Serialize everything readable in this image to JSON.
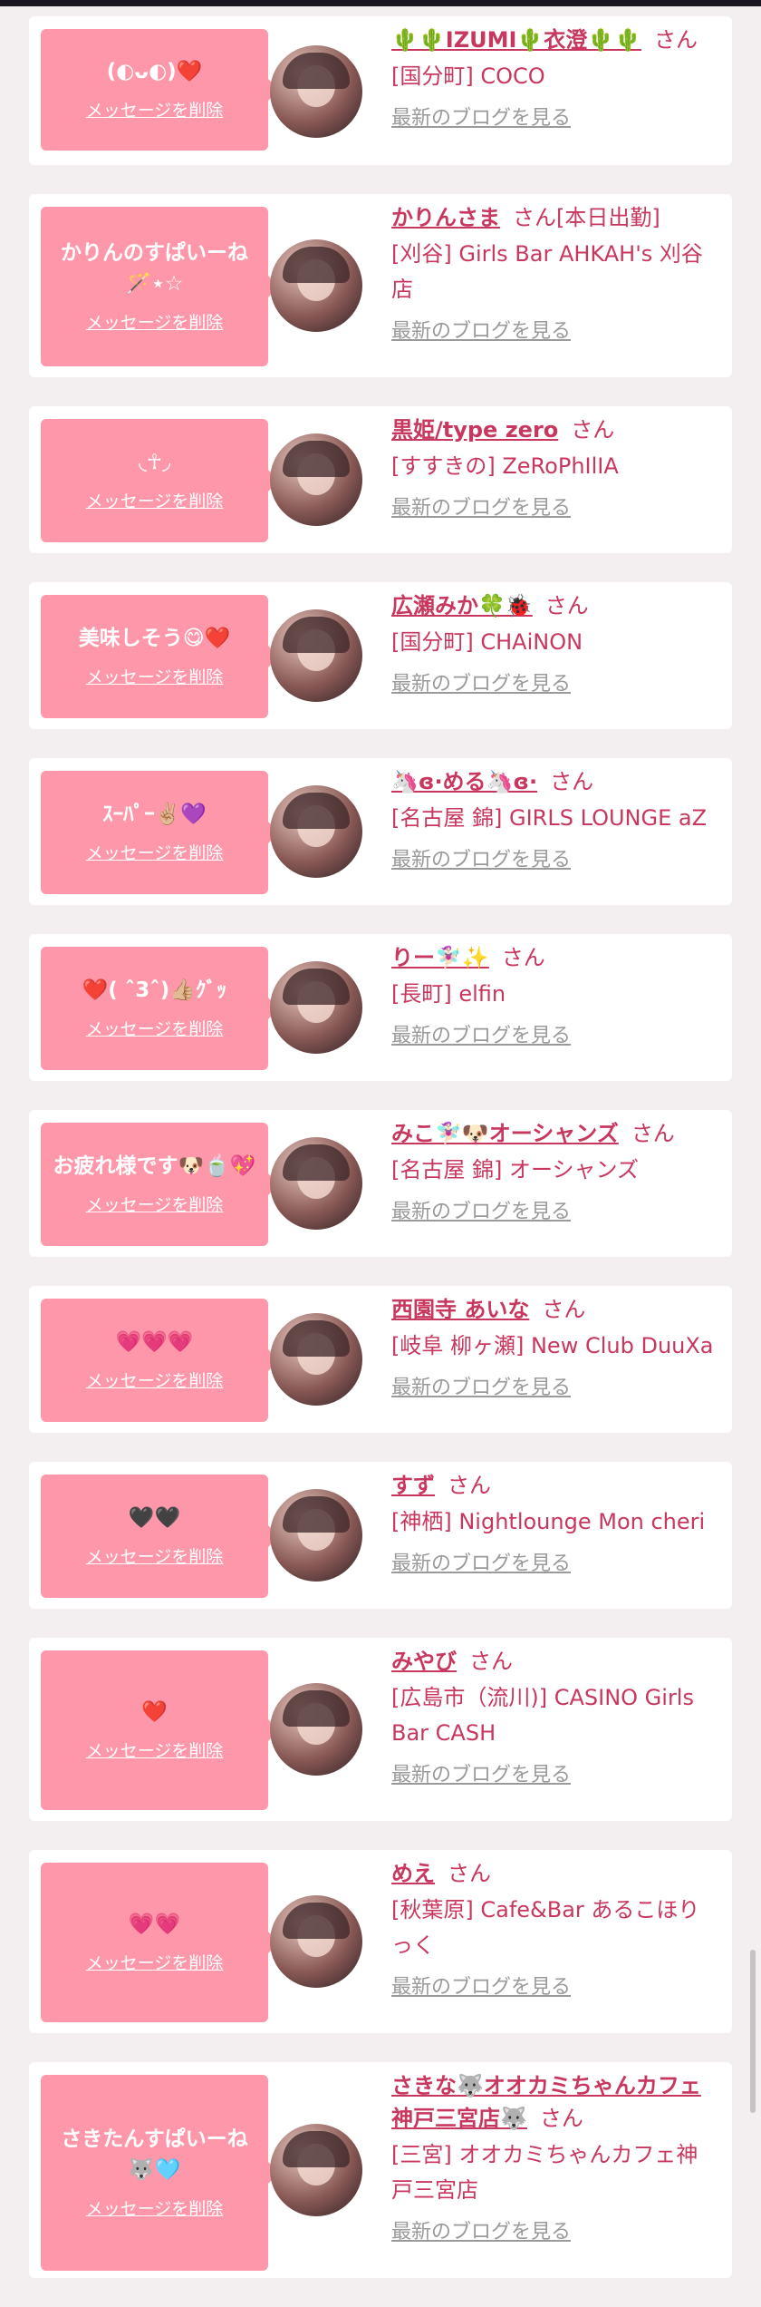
{
  "cards": [
    {
      "message": "(◐ᴗ◐)❤️",
      "delete_label": "メッセージを削除",
      "name": "🌵🌵IZUMI🌵衣澄🌵🌵",
      "suffix": "さん",
      "shop": "[国分町] COCO",
      "blog_label": "最新のブログを見る"
    },
    {
      "message": "かりんのすぱいーね🪄⋆☆",
      "delete_label": "メッセージを削除",
      "name": "かりんさま",
      "suffix": "さん[本日出勤]",
      "shop": "[刈谷] Girls Bar AHKAH's 刈谷店",
      "blog_label": "最新のブログを見る"
    },
    {
      "message": "◟☥◞",
      "delete_label": "メッセージを削除",
      "name": "黒姫/type zero",
      "suffix": "さん",
      "shop": "[すすきの] ZeRoPhIlIA",
      "blog_label": "最新のブログを見る"
    },
    {
      "message": "美味しそう😋❤️",
      "delete_label": "メッセージを削除",
      "name": "広瀬みか🍀🐞",
      "suffix": "さん",
      "shop": "[国分町] CHAiNON",
      "blog_label": "最新のブログを見る"
    },
    {
      "message": "ｽｰﾊﾟｰ✌🏼💜",
      "delete_label": "メッセージを削除",
      "name": "🦄ɞ·める🦄ɞ·",
      "suffix": "さん",
      "shop": "[名古屋 錦] GIRLS LOUNGE aZ",
      "blog_label": "最新のブログを見る"
    },
    {
      "message": "❤️( ˆ3ˆ)👍🏼ｸﾞｯ",
      "delete_label": "メッセージを削除",
      "name": "りー🧚🏻‍♀️✨",
      "suffix": "さん",
      "shop": "[長町] elfin",
      "blog_label": "最新のブログを見る"
    },
    {
      "message": "お疲れ様です🐶🍵💖",
      "delete_label": "メッセージを削除",
      "name": "みこ🧚🏻‍♀️🐶オーシャンズ",
      "suffix": "さん",
      "shop": "[名古屋 錦] オーシャンズ",
      "blog_label": "最新のブログを見る"
    },
    {
      "message": "💗💗💗",
      "delete_label": "メッセージを削除",
      "name": "西園寺 あいな",
      "suffix": "さん",
      "shop": "[岐阜 柳ヶ瀬] New Club DuuXa",
      "blog_label": "最新のブログを見る"
    },
    {
      "message": "🖤🖤",
      "delete_label": "メッセージを削除",
      "name": "すず",
      "suffix": "さん",
      "shop": "[神栖] Nightlounge Mon cheri",
      "blog_label": "最新のブログを見る"
    },
    {
      "message": "❤️",
      "delete_label": "メッセージを削除",
      "name": "みやび",
      "suffix": "さん",
      "shop": "[広島市（流川)] CASINO Girls Bar CASH",
      "blog_label": "最新のブログを見る"
    },
    {
      "message": "💗💗",
      "delete_label": "メッセージを削除",
      "name": "めえ",
      "suffix": "さん",
      "shop": "[秋葉原] Cafe&Bar あるこほりっく",
      "blog_label": "最新のブログを見る"
    },
    {
      "message": "さきたんすぱいーね🐺🩵",
      "delete_label": "メッセージを削除",
      "name": "さきな🐺オオカミちゃんカフェ神戸三宮店🐺",
      "suffix": "さん",
      "shop": "[三宮] オオカミちゃんカフェ神戸三宮店",
      "blog_label": "最新のブログを見る"
    }
  ],
  "colors": {
    "bubble": "#ff97aa",
    "name_text": "#c8385e",
    "link_gray": "#9a9a9a",
    "page_bg": "#f3eef0"
  }
}
